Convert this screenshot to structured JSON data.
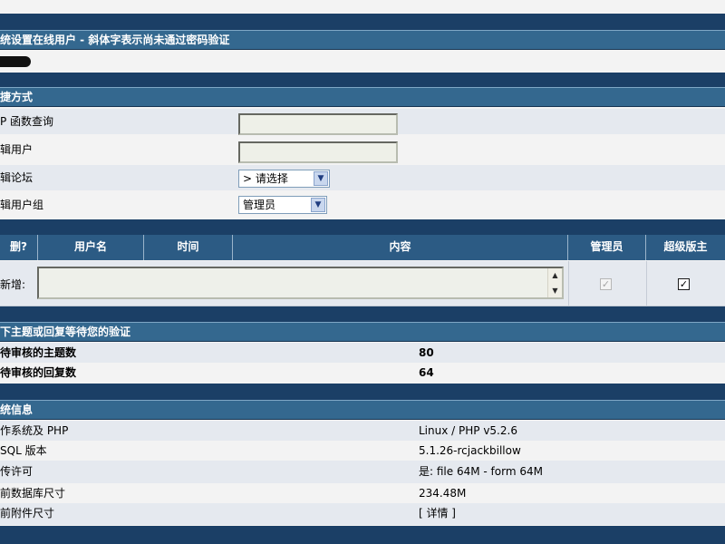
{
  "online_users": {
    "header": "统设置在线用户 - 斜体字表示尚未通过密码验证"
  },
  "shortcuts": {
    "header": "捷方式",
    "php_function_label": "P 函数查询",
    "php_function_value": "",
    "edit_user_label": "辑用户",
    "edit_user_value": "",
    "edit_forum_label": "辑论坛",
    "edit_forum_selected": "> 请选择",
    "edit_group_label": "辑用户组",
    "edit_group_selected": "管理员"
  },
  "notes_table": {
    "columns": [
      "删?",
      "用户名",
      "时间",
      "内容",
      "管理员",
      "超级版主"
    ],
    "add_label": "新增:",
    "content_value": "",
    "admin_checked": true,
    "supermod_checked": true
  },
  "moderation": {
    "header": "下主题或回复等待您的验证",
    "rows": [
      {
        "label": "待审核的主题数",
        "value": "80"
      },
      {
        "label": "待审核的回复数",
        "value": "64"
      }
    ]
  },
  "system_info": {
    "header": "统信息",
    "rows": [
      {
        "label": "作系统及 PHP",
        "value": "Linux / PHP v5.2.6"
      },
      {
        "label": "SQL 版本",
        "value": "5.1.26-rcjackbillow"
      },
      {
        "label": "传许可",
        "value": "是: file 64M - form 64M"
      },
      {
        "label": "前数据库尺寸",
        "value": "234.48M"
      },
      {
        "label": "前附件尺寸",
        "value": "[ 详情 ]"
      }
    ]
  },
  "colors": {
    "header_bg": "#34688f",
    "band_bg": "#1b3f66",
    "alt_row_bg": "#e5e9ef"
  },
  "icons": [
    "check-icon",
    "chevron-down-icon",
    "scroll-up-icon",
    "scroll-down-icon"
  ]
}
